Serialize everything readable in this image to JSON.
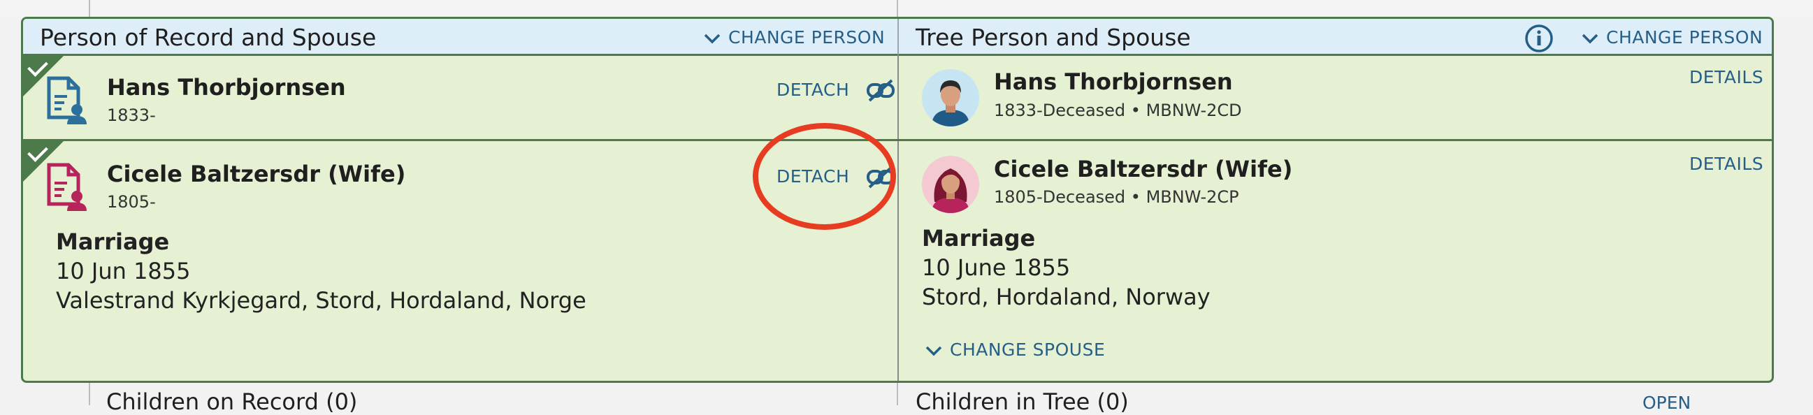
{
  "left": {
    "header": "Person of Record and Spouse",
    "change_person": "CHANGE PERSON",
    "person": {
      "name": "Hans Thorbjornsen",
      "dates": "1833-",
      "action": "DETACH"
    },
    "spouse": {
      "name": "Cicele Baltzersdr (Wife)",
      "dates": "1805-",
      "action": "DETACH"
    },
    "marriage": {
      "title": "Marriage",
      "date": "10 Jun 1855",
      "place": "Valestrand Kyrkjegard, Stord, Hordaland, Norge"
    }
  },
  "right": {
    "header": "Tree Person and Spouse",
    "change_person": "CHANGE PERSON",
    "person": {
      "name": "Hans Thorbjornsen",
      "dates": "1833-Deceased • MBNW-2CD",
      "action": "DETAILS"
    },
    "spouse": {
      "name": "Cicele Baltzersdr (Wife)",
      "dates": "1805-Deceased • MBNW-2CP",
      "action": "DETAILS"
    },
    "marriage": {
      "title": "Marriage",
      "date": "10 June 1855",
      "place": "Stord, Hordaland, Norway"
    },
    "change_spouse": "CHANGE SPOUSE"
  },
  "below": {
    "left_label": "Children on Record (0)",
    "right_label": "Children in Tree (0)",
    "right_action": "OPEN"
  },
  "colors": {
    "accent_link": "#255f88",
    "match_green": "#4d7a4b",
    "card_bg": "#e6f1d3",
    "header_bg": "#deeef9",
    "male": "#2d6f9c",
    "female": "#b7245c",
    "annotation_ring": "#e63d22"
  },
  "icons": [
    "chevron-down-icon",
    "info-icon",
    "unlink-icon",
    "record-person-icon",
    "male-avatar-icon",
    "female-avatar-icon",
    "check-icon"
  ]
}
